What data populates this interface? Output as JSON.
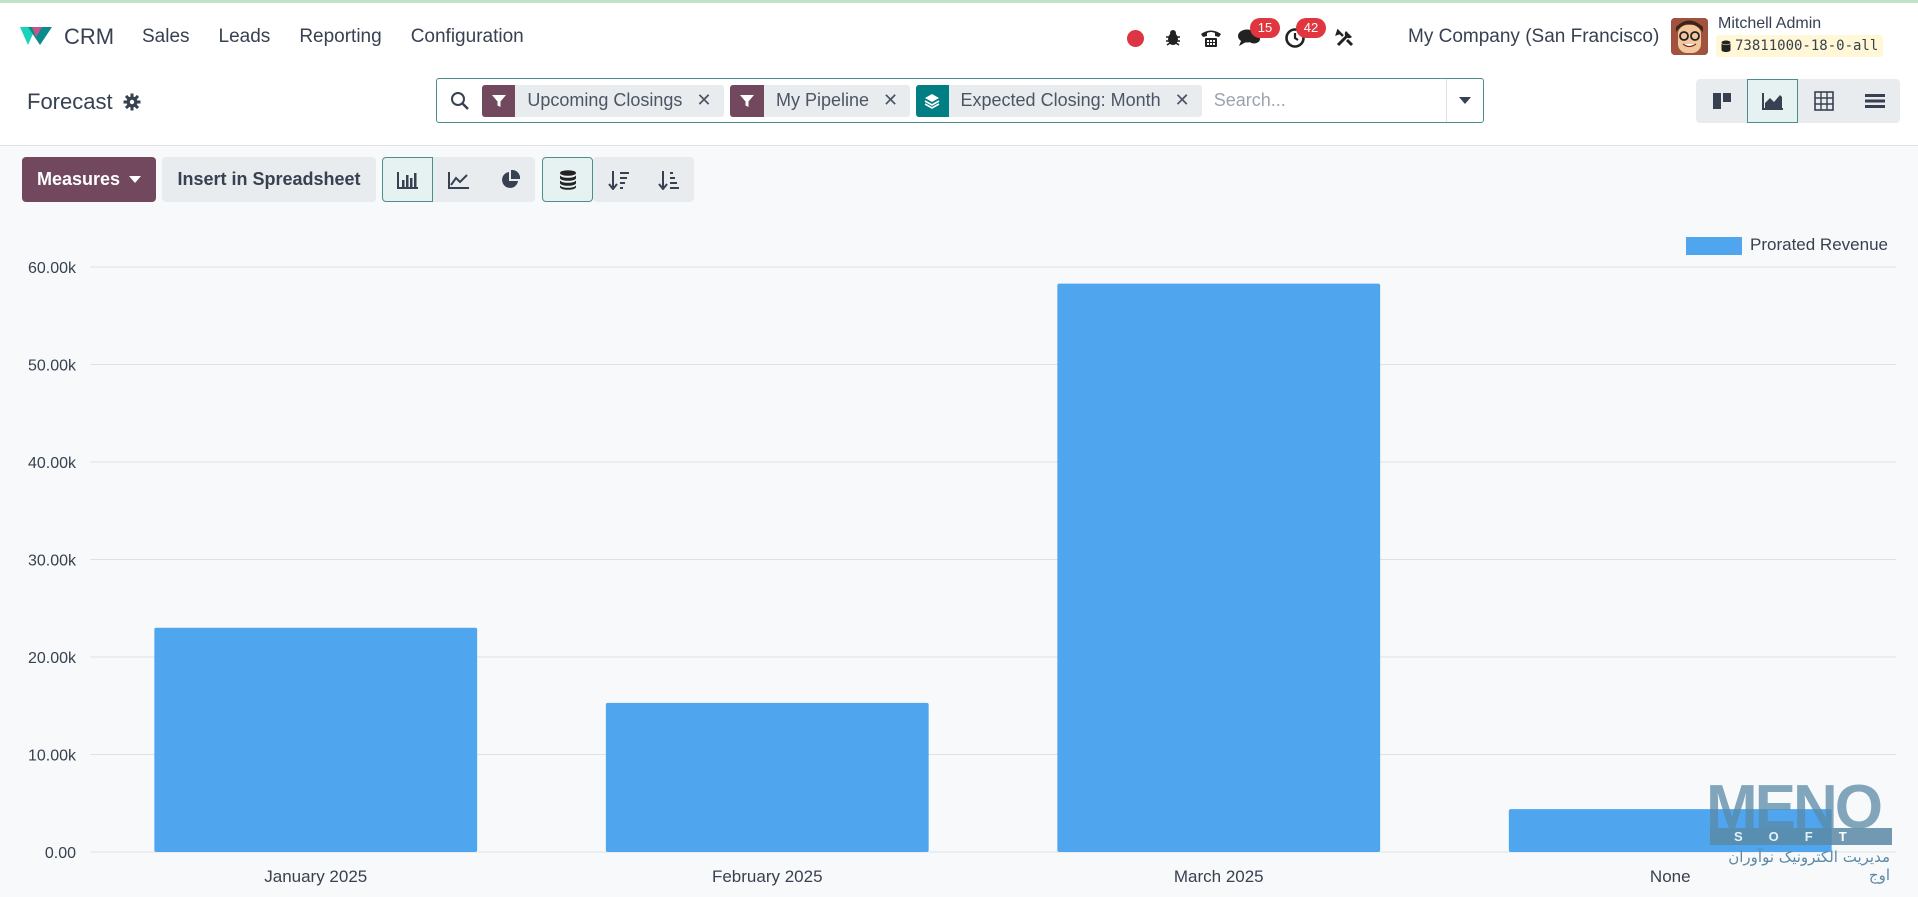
{
  "navbar": {
    "app_name": "CRM",
    "menu": [
      "Sales",
      "Leads",
      "Reporting",
      "Configuration"
    ],
    "chat_badge": "15",
    "activity_badge": "42",
    "company": "My Company (San Francisco)",
    "user_name": "Mitchell Admin",
    "db_name": "73811000-18-0-all"
  },
  "control": {
    "title": "Forecast",
    "facets": [
      {
        "type": "filter",
        "label": "Upcoming Closings"
      },
      {
        "type": "filter",
        "label": "My Pipeline"
      },
      {
        "type": "group",
        "label": "Expected Closing: Month"
      }
    ],
    "search_placeholder": "Search...",
    "views": [
      "kanban",
      "graph",
      "pivot",
      "list"
    ],
    "active_view": "graph"
  },
  "toolbar": {
    "measures_label": "Measures",
    "spreadsheet_label": "Insert in Spreadsheet"
  },
  "chart_data": {
    "type": "bar",
    "categories": [
      "January 2025",
      "February 2025",
      "March 2025",
      "None"
    ],
    "series": [
      {
        "name": "Prorated Revenue",
        "values": [
          23000,
          15300,
          58300,
          4400
        ],
        "color": "#4fa5ee"
      }
    ],
    "ylim": [
      0,
      60000
    ],
    "yticks": [
      "0.00",
      "10.00k",
      "20.00k",
      "30.00k",
      "40.00k",
      "50.00k",
      "60.00k"
    ],
    "grid": true,
    "legend": "top-right"
  },
  "watermark": {
    "brand": "MENO",
    "sub": "SOFT",
    "fa": "مدیریت الکترونیک نوآوران اوج"
  }
}
